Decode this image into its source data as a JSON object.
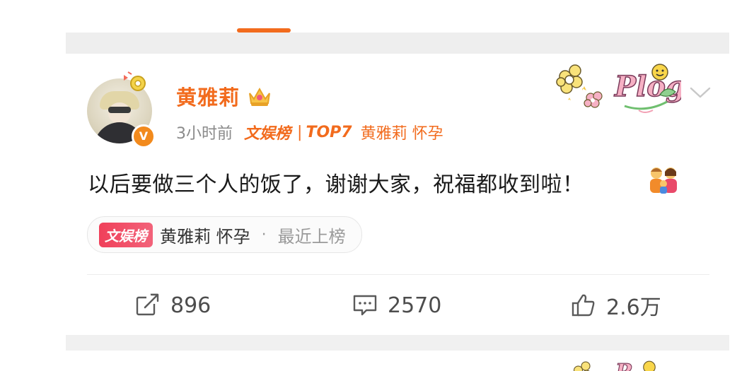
{
  "user": {
    "name": "黄雅莉",
    "verified_badge": "V"
  },
  "meta": {
    "time": "3小时前",
    "source": "文娱榜",
    "separator": "|",
    "rank": "TOP7",
    "topic": "黄雅莉 怀孕"
  },
  "post": {
    "text": "以后要做三个人的饭了，谢谢大家，祝福都收到啦！"
  },
  "topic_pill": {
    "badge": "文娱榜",
    "topic": "黄雅莉 怀孕",
    "dot": "·",
    "status": "最近上榜"
  },
  "actions": {
    "repost_count": "896",
    "comment_count": "2570",
    "like_count": "2.6万"
  },
  "icons": {
    "crown": "crown-icon",
    "sticker": "plog-sticker",
    "menu": "chevron-down-icon",
    "emoji": "couple-emoji",
    "repost": "repost-icon",
    "comment": "comment-icon",
    "like": "like-icon"
  },
  "colors": {
    "accent": "#f26b1d",
    "text": "#1a1a1a",
    "muted": "#8a8a8a",
    "badge_red": "#f0405a"
  }
}
